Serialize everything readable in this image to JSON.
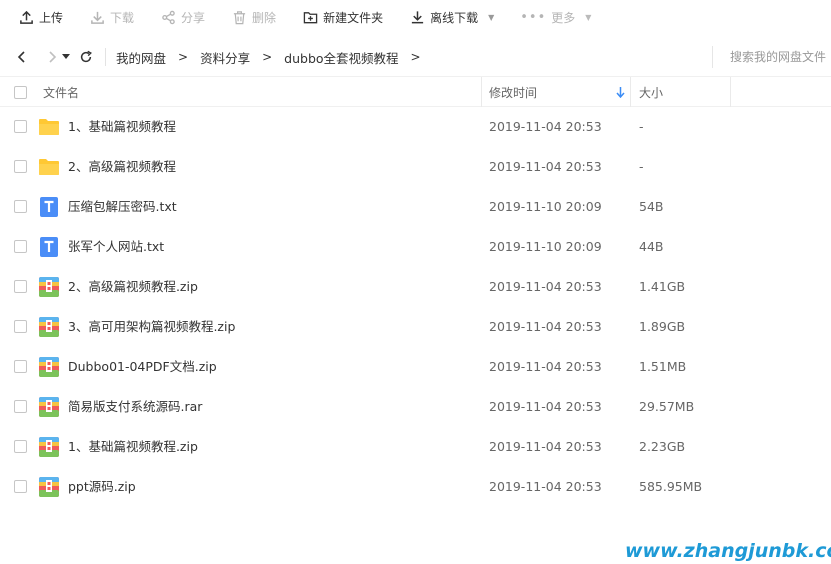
{
  "toolbar": {
    "upload": "上传",
    "download": "下载",
    "share": "分享",
    "delete": "删除",
    "new_folder": "新建文件夹",
    "offline_download": "离线下载",
    "more": "更多"
  },
  "breadcrumb": [
    "我的网盘",
    "资料分享",
    "dubbo全套视频教程"
  ],
  "search": {
    "placeholder": "搜索我的网盘文件"
  },
  "columns": {
    "name": "文件名",
    "modified": "修改时间",
    "size": "大小"
  },
  "files": [
    {
      "type": "folder",
      "name": "1、基础篇视频教程",
      "modified": "2019-11-04 20:53",
      "size": "-"
    },
    {
      "type": "folder",
      "name": "2、高级篇视频教程",
      "modified": "2019-11-04 20:53",
      "size": "-"
    },
    {
      "type": "txt",
      "name": "压缩包解压密码.txt",
      "modified": "2019-11-10 20:09",
      "size": "54B"
    },
    {
      "type": "txt",
      "name": "张军个人网站.txt",
      "modified": "2019-11-10 20:09",
      "size": "44B"
    },
    {
      "type": "zip",
      "name": "2、高级篇视频教程.zip",
      "modified": "2019-11-04 20:53",
      "size": "1.41GB"
    },
    {
      "type": "zip",
      "name": "3、高可用架构篇视频教程.zip",
      "modified": "2019-11-04 20:53",
      "size": "1.89GB"
    },
    {
      "type": "zip",
      "name": "Dubbo01-04PDF文档.zip",
      "modified": "2019-11-04 20:53",
      "size": "1.51MB"
    },
    {
      "type": "zip",
      "name": "简易版支付系统源码.rar",
      "modified": "2019-11-04 20:53",
      "size": "29.57MB"
    },
    {
      "type": "zip",
      "name": "1、基础篇视频教程.zip",
      "modified": "2019-11-04 20:53",
      "size": "2.23GB"
    },
    {
      "type": "zip",
      "name": "ppt源码.zip",
      "modified": "2019-11-04 20:53",
      "size": "585.95MB"
    }
  ],
  "watermark": "www.zhangjunbk.com",
  "colors": {
    "accent": "#1e9ad6",
    "folder": "#ffc833",
    "txt": "#4a8df7"
  }
}
